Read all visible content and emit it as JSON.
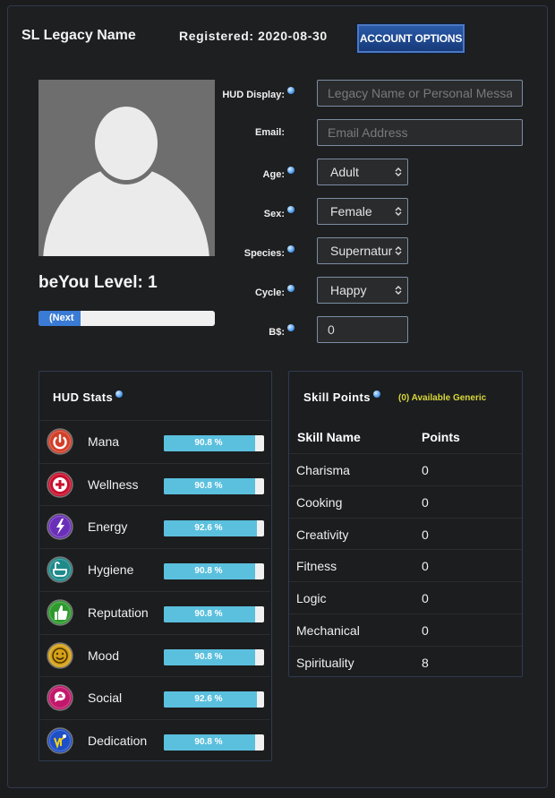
{
  "header": {
    "legacy_name": "SL Legacy Name",
    "registered": "Registered: 2020-08-30",
    "account_button": "ACCOUNT OPTIONS"
  },
  "profile": {
    "level_text": "beYou Level: 1",
    "level_bar_label": "(Next",
    "level_progress_percent": 24
  },
  "form": {
    "hud_display": {
      "label": "HUD Display:",
      "value": "",
      "placeholder": "Legacy Name or Personal Message"
    },
    "email": {
      "label": "Email:",
      "value": "",
      "placeholder": "Email Address"
    },
    "age": {
      "label": "Age:",
      "value": "Adult"
    },
    "sex": {
      "label": "Sex:",
      "value": "Female"
    },
    "species": {
      "label": "Species:",
      "value": "Supernatural"
    },
    "cycle": {
      "label": "Cycle:",
      "value": "Happy"
    },
    "bucks": {
      "label": "B$:",
      "value": "0"
    }
  },
  "hud_stats": {
    "title": "HUD Stats",
    "items": [
      {
        "name": "Mana",
        "value": "90.8 %",
        "percent": 90.8,
        "icon": "power-icon",
        "color": "#d2402a"
      },
      {
        "name": "Wellness",
        "value": "90.8 %",
        "percent": 90.8,
        "icon": "medical-cross-icon",
        "color": "#c8102e"
      },
      {
        "name": "Energy",
        "value": "92.6 %",
        "percent": 92.6,
        "icon": "lightning-icon",
        "color": "#6a2fb8"
      },
      {
        "name": "Hygiene",
        "value": "90.8 %",
        "percent": 90.8,
        "icon": "bathtub-icon",
        "color": "#1f8a8a"
      },
      {
        "name": "Reputation",
        "value": "90.8 %",
        "percent": 90.8,
        "icon": "thumbs-up-icon",
        "color": "#2e9a2e"
      },
      {
        "name": "Mood",
        "value": "90.8 %",
        "percent": 90.8,
        "icon": "smiley-icon",
        "color": "#d4a017"
      },
      {
        "name": "Social",
        "value": "92.6 %",
        "percent": 92.6,
        "icon": "speech-bubble-icon",
        "color": "#c2186b"
      },
      {
        "name": "Dedication",
        "value": "90.8 %",
        "percent": 90.8,
        "icon": "dedication-icon",
        "color": "#1e4fc7"
      }
    ]
  },
  "skills": {
    "title": "Skill Points",
    "available": "(0) Available Generic",
    "col_name": "Skill Name",
    "col_points": "Points",
    "items": [
      {
        "name": "Charisma",
        "points": "0"
      },
      {
        "name": "Cooking",
        "points": "0"
      },
      {
        "name": "Creativity",
        "points": "0"
      },
      {
        "name": "Fitness",
        "points": "0"
      },
      {
        "name": "Logic",
        "points": "0"
      },
      {
        "name": "Mechanical",
        "points": "0"
      },
      {
        "name": "Spirituality",
        "points": "8"
      }
    ]
  },
  "colors": {
    "accent": "#3a7bd5",
    "stat_fill": "#5bc0de",
    "highlight": "#d8d83a"
  }
}
